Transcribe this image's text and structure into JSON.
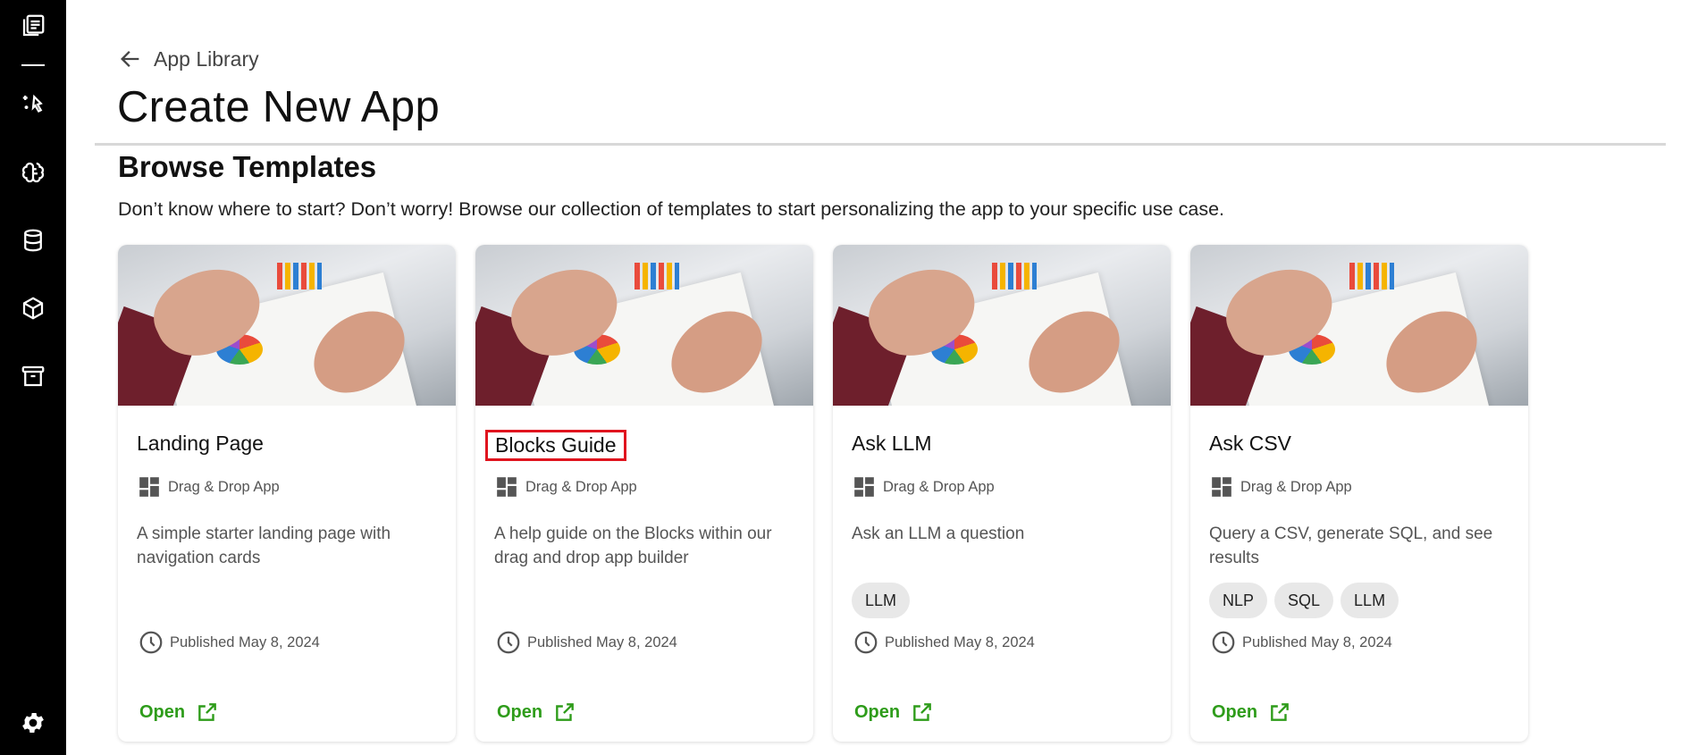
{
  "sidebar": {
    "items": [
      {
        "icon": "library-icon"
      },
      {
        "icon": "sparkle-cursor-icon"
      },
      {
        "icon": "brain-icon"
      },
      {
        "icon": "database-icon"
      },
      {
        "icon": "cube-icon"
      },
      {
        "icon": "archive-icon"
      },
      {
        "icon": "gear-icon"
      }
    ]
  },
  "header": {
    "breadcrumb": "App Library",
    "title": "Create New App"
  },
  "templates": {
    "title": "Browse Templates",
    "description": "Don’t know where to start? Don’t worry! Browse our collection of templates to start personalizing the app to your specific use case.",
    "cards": [
      {
        "title": "Landing Page",
        "type": "Drag & Drop App",
        "description": "A simple starter landing page with navigation cards",
        "tags": [],
        "published": "Published May 8, 2024",
        "action": "Open"
      },
      {
        "title": "Blocks Guide",
        "type": "Drag & Drop App",
        "description": "A help guide on the Blocks within our drag and drop app builder",
        "tags": [],
        "published": "Published May 8, 2024",
        "action": "Open"
      },
      {
        "title": "Ask LLM",
        "type": "Drag & Drop App",
        "description": "Ask an LLM a question",
        "tags": [
          "LLM"
        ],
        "published": "Published May 8, 2024",
        "action": "Open"
      },
      {
        "title": "Ask CSV",
        "type": "Drag & Drop App",
        "description": "Query a CSV, generate SQL, and see results",
        "tags": [
          "NLP",
          "SQL",
          "LLM"
        ],
        "published": "Published May 8, 2024",
        "action": "Open"
      }
    ]
  },
  "colors": {
    "sidebar_bg": "#000000",
    "accent_green": "#2e9c1a",
    "highlight_red": "#e0141e"
  }
}
